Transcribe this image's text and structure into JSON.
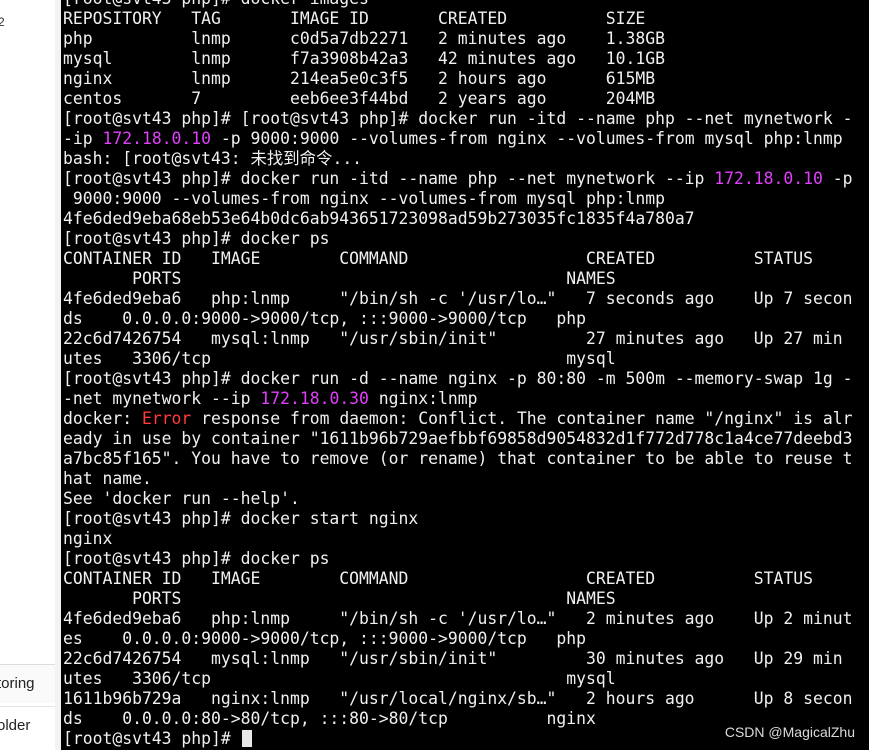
{
  "left_panel": {
    "top_fragment": "2",
    "items": [
      {
        "label": "toring"
      },
      {
        "label": "older"
      }
    ]
  },
  "terminal": {
    "lines": [
      [
        {
          "t": "[root@svt43 php]# docker images"
        }
      ],
      [
        {
          "t": "REPOSITORY   TAG       IMAGE ID       CREATED          SIZE"
        }
      ],
      [
        {
          "t": "php          lnmp      c0d5a7db2271   2 minutes ago    1.38GB"
        }
      ],
      [
        {
          "t": "mysql        lnmp      f7a3908b42a3   42 minutes ago   10.1GB"
        }
      ],
      [
        {
          "t": "nginx        lnmp      214ea5e0c3f5   2 hours ago      615MB"
        }
      ],
      [
        {
          "t": "centos       7         eeb6ee3f44bd   2 years ago      204MB"
        }
      ],
      [
        {
          "t": "[root@svt43 php]# [root@svt43 php]# docker run -itd --name php --net mynetwork -"
        }
      ],
      [
        {
          "t": "-ip "
        },
        {
          "t": "172.18.0.10",
          "c": "ip"
        },
        {
          "t": " -p 9000:9000 --volumes-from nginx --volumes-from mysql php:lnmp"
        }
      ],
      [
        {
          "t": "bash: [root@svt43: 未找到命令..."
        }
      ],
      [
        {
          "t": "[root@svt43 php]# docker run -itd --name php --net mynetwork --ip "
        },
        {
          "t": "172.18.0.10",
          "c": "ip"
        },
        {
          "t": " -p"
        }
      ],
      [
        {
          "t": " 9000:9000 --volumes-from nginx --volumes-from mysql php:lnmp"
        }
      ],
      [
        {
          "t": "4fe6ded9eba68eb53e64b0dc6ab943651723098ad59b273035fc1835f4a780a7"
        }
      ],
      [
        {
          "t": "[root@svt43 php]# docker ps"
        }
      ],
      [
        {
          "t": "CONTAINER ID   IMAGE        COMMAND                  CREATED          STATUS"
        }
      ],
      [
        {
          "t": "       PORTS                                       NAMES"
        }
      ],
      [
        {
          "t": "4fe6ded9eba6   php:lnmp     \"/bin/sh -c '/usr/lo…\"   7 seconds ago    Up 7 secon"
        }
      ],
      [
        {
          "t": "ds    0.0.0.0:9000->9000/tcp, :::9000->9000/tcp   php"
        }
      ],
      [
        {
          "t": "22c6d7426754   mysql:lnmp   \"/usr/sbin/init\"         27 minutes ago   Up 27 min"
        }
      ],
      [
        {
          "t": "utes   3306/tcp                                    mysql"
        }
      ],
      [
        {
          "t": "[root@svt43 php]# docker run -d --name nginx -p 80:80 -m 500m --memory-swap 1g -"
        }
      ],
      [
        {
          "t": "-net mynetwork --ip "
        },
        {
          "t": "172.18.0.30",
          "c": "ip"
        },
        {
          "t": " nginx:lnmp"
        }
      ],
      [
        {
          "t": "docker: "
        },
        {
          "t": "Error",
          "c": "err"
        },
        {
          "t": " response from daemon: Conflict. The container name \"/nginx\" is alr"
        }
      ],
      [
        {
          "t": "eady in use by container \"1611b96b729aefbbf69858d9054832d1f772d778c1a4ce77deebd3"
        }
      ],
      [
        {
          "t": "a7bc85f165\". You have to remove (or rename) that container to be able to reuse t"
        }
      ],
      [
        {
          "t": "hat name."
        }
      ],
      [
        {
          "t": "See 'docker run --help'."
        }
      ],
      [
        {
          "t": "[root@svt43 php]# docker start nginx"
        }
      ],
      [
        {
          "t": "nginx"
        }
      ],
      [
        {
          "t": "[root@svt43 php]# docker ps"
        }
      ],
      [
        {
          "t": "CONTAINER ID   IMAGE        COMMAND                  CREATED          STATUS"
        }
      ],
      [
        {
          "t": "       PORTS                                       NAMES"
        }
      ],
      [
        {
          "t": "4fe6ded9eba6   php:lnmp     \"/bin/sh -c '/usr/lo…\"   2 minutes ago    Up 2 minut"
        }
      ],
      [
        {
          "t": "es    0.0.0.0:9000->9000/tcp, :::9000->9000/tcp   php"
        }
      ],
      [
        {
          "t": "22c6d7426754   mysql:lnmp   \"/usr/sbin/init\"         30 minutes ago   Up 29 min"
        }
      ],
      [
        {
          "t": "utes   3306/tcp                                    mysql"
        }
      ],
      [
        {
          "t": "1611b96b729a   nginx:lnmp   \"/usr/local/nginx/sb…\"   2 hours ago      Up 8 secon"
        }
      ],
      [
        {
          "t": "ds    0.0.0.0:80->80/tcp, :::80->80/tcp          nginx"
        }
      ],
      [
        {
          "t": "[root@svt43 php]# "
        }
      ]
    ],
    "cursor": "block"
  },
  "watermark": "CSDN @MagicalZhu",
  "colors": {
    "terminal_bg": "#000000",
    "terminal_fg": "#f0f0f0",
    "ip_highlight": "#e040fb",
    "error_highlight": "#ff3b3b"
  }
}
